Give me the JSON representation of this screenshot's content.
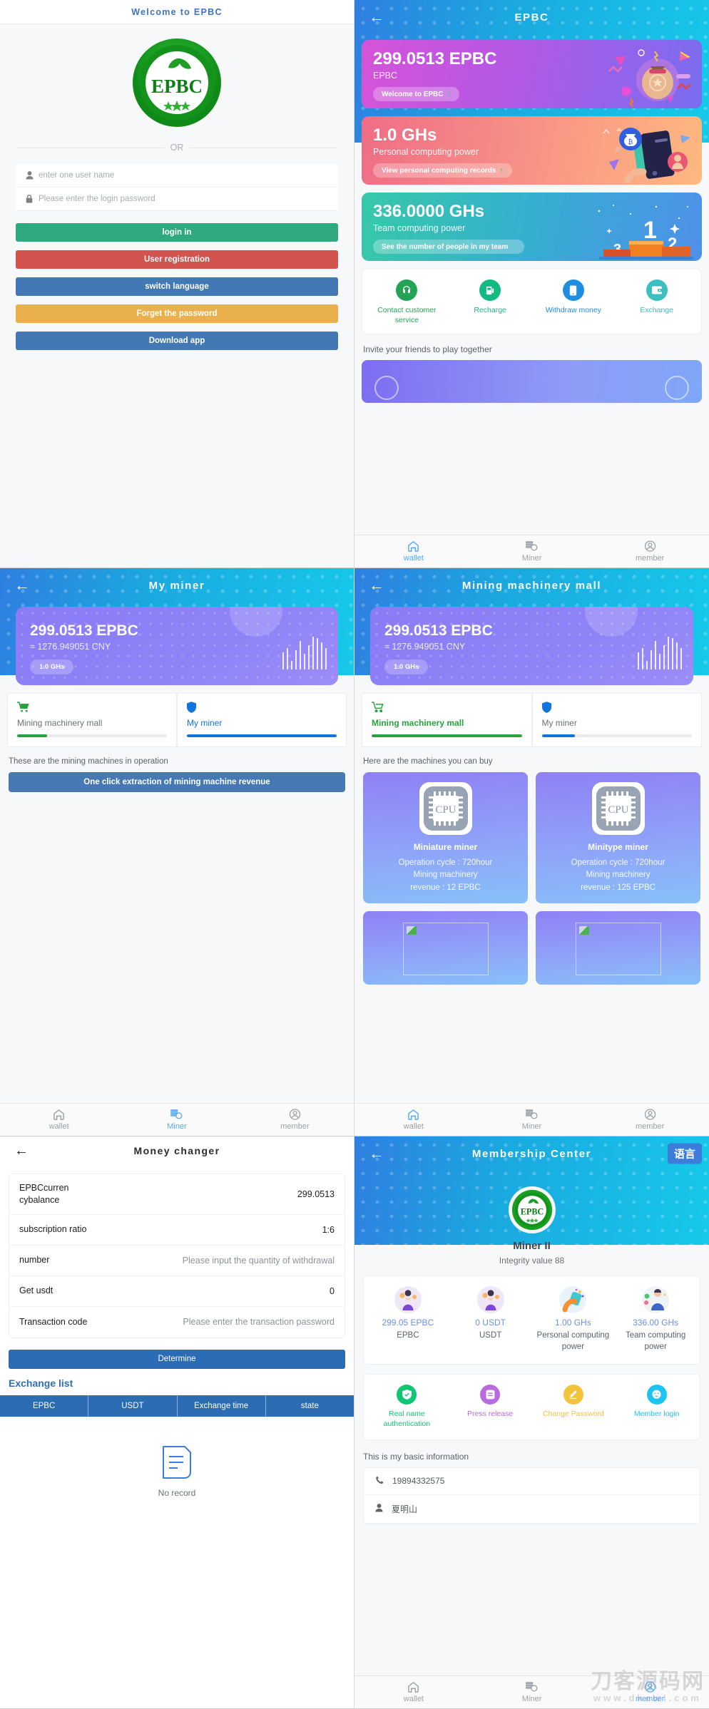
{
  "login": {
    "header": "Welcome to EPBC",
    "logo_text": "EPBC",
    "divider": "OR",
    "username_placeholder": "enter one user name",
    "password_placeholder": "Please enter the login password",
    "buttons": [
      {
        "label": "login in",
        "color": "#31a97f"
      },
      {
        "label": "User registration",
        "color": "#d1544e"
      },
      {
        "label": "switch language",
        "color": "#4279b4"
      },
      {
        "label": "Forget the password",
        "color": "#eab04e"
      },
      {
        "label": "Download app",
        "color": "#4279b4"
      }
    ]
  },
  "wallet": {
    "title": "EPBC",
    "cards": [
      {
        "value": "299.0513 EPBC",
        "label": "EPBC",
        "action": "Welcome to EPBC"
      },
      {
        "value": "1.0 GHs",
        "label": "Personal computing power",
        "action": "View personal computing records"
      },
      {
        "value": "336.0000 GHs",
        "label": "Team computing power",
        "action": "See the number of people in my team"
      }
    ],
    "quick_actions": [
      {
        "label": "Contact customer service",
        "color": "#23a455"
      },
      {
        "label": "Recharge",
        "color": "#12b981"
      },
      {
        "label": "Withdraw money",
        "color": "#1f8ee0"
      },
      {
        "label": "Exchange",
        "color": "#3bbfc0"
      }
    ],
    "invite_title": "Invite your friends to play together"
  },
  "my_miner": {
    "title": "My miner",
    "balance": "299.0513 EPBC",
    "cny": "≈ 1276.949051 CNY",
    "ghs": "1.0 GHs",
    "tabs": [
      {
        "label": "Mining machinery mall",
        "color": "#2aa13f",
        "progress": 20,
        "active": false
      },
      {
        "label": "My miner",
        "color": "#1174dd",
        "progress": 100,
        "active": true
      }
    ],
    "hint": "These are the mining machines in operation",
    "extract_button": "One click extraction of mining machine revenue"
  },
  "mall": {
    "title": "Mining machinery mall",
    "balance": "299.0513 EPBC",
    "cny": "≈ 1276.949051 CNY",
    "ghs": "1.0 GHs",
    "tabs": [
      {
        "label": "Mining machinery mall",
        "color": "#2aa13f",
        "progress": 100,
        "active": true
      },
      {
        "label": "My miner",
        "color": "#1174dd",
        "progress": 22,
        "active": false
      }
    ],
    "hint": "Here are the machines you can buy",
    "products": [
      {
        "name": "Miniature miner",
        "cycle": "Operation cycle : 720hour",
        "revenue_l1": "Mining machinery",
        "revenue_l2": "revenue : 12 EPBC",
        "image": "cpu-chip"
      },
      {
        "name": "Minitype miner",
        "cycle": "Operation cycle : 720hour",
        "revenue_l1": "Mining machinery",
        "revenue_l2": "revenue : 125 EPBC",
        "image": "cpu-chip"
      },
      {
        "name": "",
        "cycle": "",
        "revenue_l1": "",
        "revenue_l2": "",
        "image": "broken-image"
      },
      {
        "name": "",
        "cycle": "",
        "revenue_l1": "",
        "revenue_l2": "",
        "image": "broken-image"
      }
    ]
  },
  "money_changer": {
    "title": "Money changer",
    "rows": [
      {
        "key": "EPBCcurren cybalance",
        "value": "299.0513",
        "type": "value"
      },
      {
        "key": "subscription ratio",
        "value": "1:6",
        "type": "value"
      },
      {
        "key": "number",
        "value": "Please input the quantity of withdrawal",
        "type": "placeholder"
      },
      {
        "key": "Get usdt",
        "value": "0",
        "type": "value"
      },
      {
        "key": "Transaction code",
        "value": "Please enter the transaction password",
        "type": "placeholder"
      }
    ],
    "determine_button": "Determine",
    "exchange_list_title": "Exchange list",
    "table_headers": [
      "EPBC",
      "USDT",
      "Exchange time",
      "state"
    ],
    "empty_text": "No record"
  },
  "member": {
    "title": "Membership Center",
    "lang_button": "语言",
    "logo_text": "EPBC",
    "rank": "Miner II",
    "integrity": "Integrity value 88",
    "stats": [
      {
        "value": "299.05 EPBC",
        "label": "EPBC"
      },
      {
        "value": "0 USDT",
        "label": "USDT"
      },
      {
        "value": "1.00 GHs",
        "label": "Personal computing power"
      },
      {
        "value": "336.00 GHs",
        "label": "Team computing power"
      }
    ],
    "actions": [
      {
        "label": "Real name authentication",
        "color": "#0fc773"
      },
      {
        "label": "Press release",
        "color": "#b86ae0"
      },
      {
        "label": "Change Password",
        "color": "#f2c33b"
      },
      {
        "label": "Member login",
        "color": "#1ec4f0"
      }
    ],
    "basic_title": "This is my basic information",
    "info_rows": [
      {
        "icon": "phone-icon",
        "value": "19894332575"
      },
      {
        "icon": "user-icon",
        "value": "夏明山"
      }
    ]
  },
  "tabbar": {
    "items": [
      {
        "label": "wallet"
      },
      {
        "label": "Miner"
      },
      {
        "label": "member"
      }
    ]
  },
  "watermark": {
    "main": "刀客源码网",
    "sub": "www.dkewl.com"
  }
}
